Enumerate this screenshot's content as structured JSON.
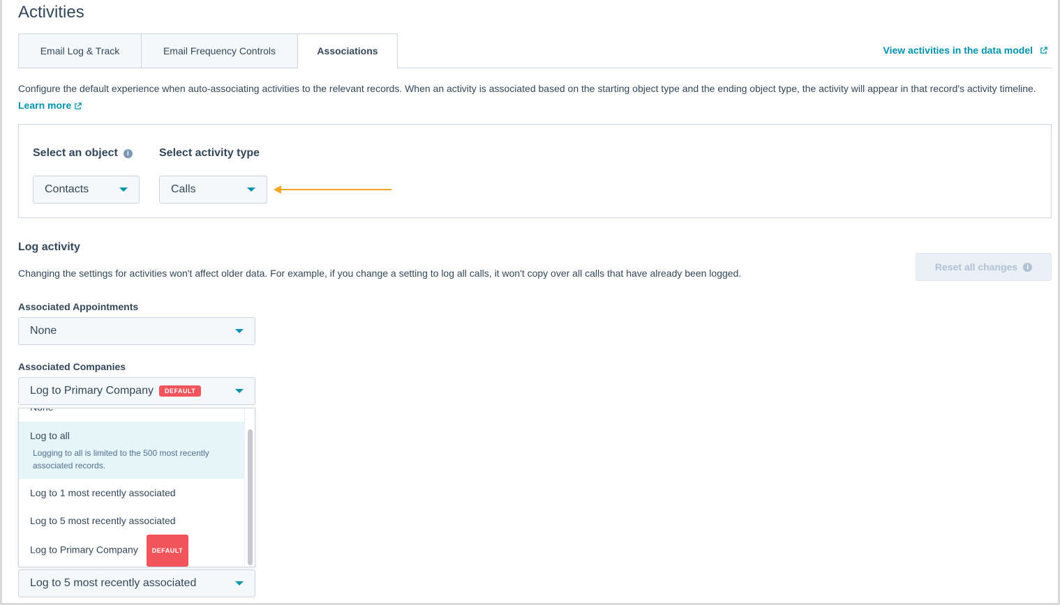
{
  "page": {
    "title": "Activities"
  },
  "tabs": [
    {
      "label": "Email Log & Track"
    },
    {
      "label": "Email Frequency Controls"
    },
    {
      "label": "Associations"
    }
  ],
  "view_link": {
    "label": "View activities in the data model"
  },
  "description": {
    "text": "Configure the default experience when auto-associating activities to the relevant records. When an activity is associated based on the starting object type and the ending object type, the activity will appear in that record's activity timeline.",
    "learn_more": "Learn more"
  },
  "selectors": {
    "object_label": "Select an object",
    "object_value": "Contacts",
    "activity_label": "Select activity type",
    "activity_value": "Calls"
  },
  "log_activity": {
    "title": "Log activity",
    "description": "Changing the settings for activities won't affect older data. For example, if you change a setting to log all calls, it won't copy over all calls that have already been logged.",
    "reset_label": "Reset all changes"
  },
  "fields": {
    "appointments": {
      "label": "Associated Appointments",
      "value": "None"
    },
    "companies": {
      "label": "Associated Companies",
      "value": "Log to Primary Company",
      "badge": "DEFAULT"
    },
    "bottom": {
      "value": "Log to 5 most recently associated"
    }
  },
  "menu": {
    "partial_top": "None",
    "items": [
      {
        "label": "Log to all",
        "sub": "Logging to all is limited to the 500 most recently associated records."
      },
      {
        "label": "Log to 1 most recently associated"
      },
      {
        "label": "Log to 5 most recently associated"
      },
      {
        "label": "Log to Primary Company",
        "badge": "DEFAULT"
      }
    ]
  },
  "colors": {
    "accent": "#0091ae",
    "badge": "#f2545b",
    "arrow": "#f5a623",
    "highlight": "#e5f5f8"
  }
}
